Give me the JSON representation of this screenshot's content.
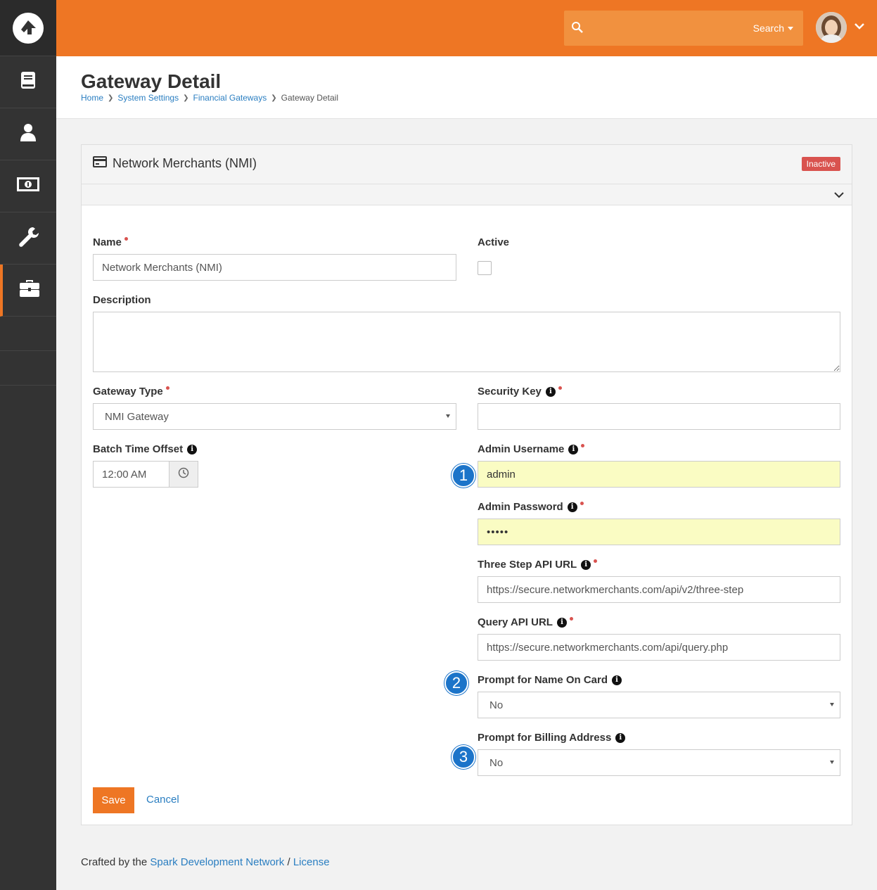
{
  "header": {
    "search_placeholder": "",
    "search_label": "Search"
  },
  "page": {
    "title": "Gateway Detail",
    "breadcrumb": [
      "Home",
      "System Settings",
      "Financial Gateways",
      "Gateway Detail"
    ]
  },
  "panel": {
    "title": "Network Merchants (NMI)",
    "status_badge": "Inactive"
  },
  "form": {
    "name_label": "Name",
    "name_value": "Network Merchants (NMI)",
    "active_label": "Active",
    "active_checked": false,
    "description_label": "Description",
    "description_value": "",
    "gateway_type_label": "Gateway Type",
    "gateway_type_value": "NMI Gateway",
    "batch_time_offset_label": "Batch Time Offset",
    "batch_time_offset_value": "12:00 AM",
    "security_key_label": "Security Key",
    "security_key_value": "",
    "admin_username_label": "Admin Username",
    "admin_username_value": "admin",
    "admin_password_label": "Admin Password",
    "admin_password_value": "•••••",
    "three_step_url_label": "Three Step API URL",
    "three_step_url_value": "https://secure.networkmerchants.com/api/v2/three-step",
    "query_api_url_label": "Query API URL",
    "query_api_url_value": "https://secure.networkmerchants.com/api/query.php",
    "prompt_name_label": "Prompt for Name On Card",
    "prompt_name_value": "No",
    "prompt_billing_label": "Prompt for Billing Address",
    "prompt_billing_value": "No"
  },
  "callouts": [
    "1",
    "2",
    "3"
  ],
  "actions": {
    "save": "Save",
    "cancel": "Cancel"
  },
  "footer": {
    "prefix": "Crafted by the",
    "link1": "Spark Development Network",
    "sep": "/",
    "link2": "License"
  },
  "colors": {
    "brand_orange": "#ee7624",
    "sidebar": "#333333",
    "link_blue": "#2a7ec1",
    "inactive_red": "#d9534f",
    "highlight_yellow": "#fafcc3",
    "callout_blue": "#1c74c9"
  },
  "icons": {
    "sidebar": [
      "rock-logo-icon",
      "book-icon",
      "user-icon",
      "money-icon",
      "wrench-icon",
      "briefcase-icon"
    ]
  }
}
